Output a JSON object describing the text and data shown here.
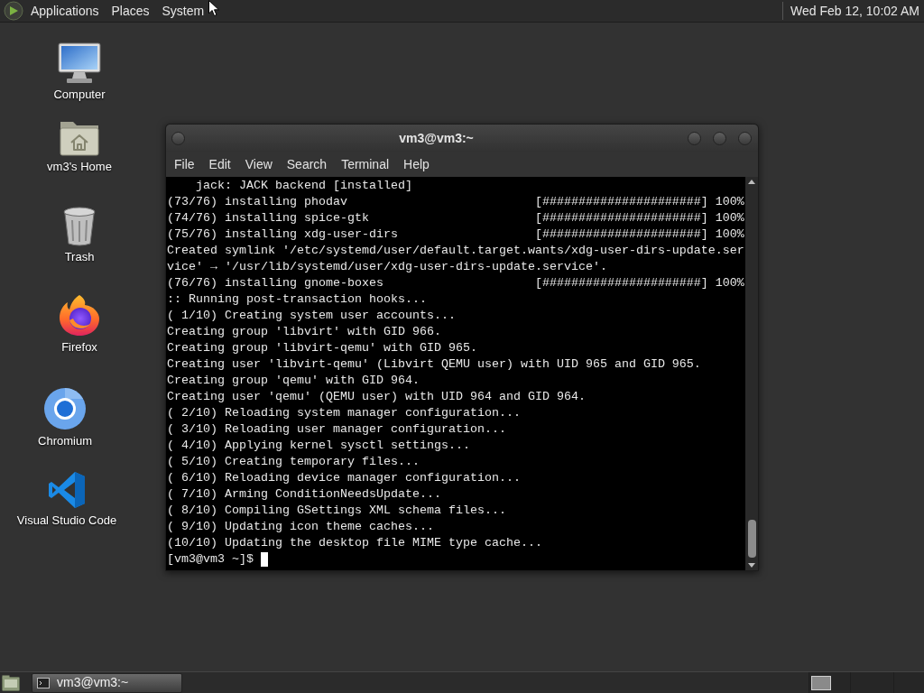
{
  "top_panel": {
    "menus": [
      "Applications",
      "Places",
      "System"
    ],
    "clock": "Wed Feb 12, 10:02 AM"
  },
  "desktop_icons": [
    {
      "label": "Computer",
      "kind": "computer"
    },
    {
      "label": "vm3's Home",
      "kind": "home"
    },
    {
      "label": "Trash",
      "kind": "trash"
    },
    {
      "label": "Firefox",
      "kind": "firefox"
    },
    {
      "label": "Chromium",
      "kind": "chromium"
    },
    {
      "label": "Visual Studio Code",
      "kind": "vscode"
    }
  ],
  "terminal_window": {
    "title": "vm3@vm3:~",
    "menu": [
      "File",
      "Edit",
      "View",
      "Search",
      "Terminal",
      "Help"
    ],
    "lines": [
      {
        "kind": "detail",
        "text": "jack: JACK backend [installed]"
      },
      {
        "kind": "progress",
        "text": "(73/76) installing phodav",
        "bar": "[######################] 100%"
      },
      {
        "kind": "progress",
        "text": "(74/76) installing spice-gtk",
        "bar": "[######################] 100%"
      },
      {
        "kind": "progress",
        "text": "(75/76) installing xdg-user-dirs",
        "bar": "[######################] 100%"
      },
      {
        "kind": "plain",
        "text": "Created symlink '/etc/systemd/user/default.target.wants/xdg-user-dirs-update.ser"
      },
      {
        "kind": "plain",
        "text": "vice' → '/usr/lib/systemd/user/xdg-user-dirs-update.service'."
      },
      {
        "kind": "progress",
        "text": "(76/76) installing gnome-boxes",
        "bar": "[######################] 100%"
      },
      {
        "kind": "plain",
        "text": ":: Running post-transaction hooks..."
      },
      {
        "kind": "plain",
        "text": "( 1/10) Creating system user accounts..."
      },
      {
        "kind": "plain",
        "text": "Creating group 'libvirt' with GID 966."
      },
      {
        "kind": "plain",
        "text": "Creating group 'libvirt-qemu' with GID 965."
      },
      {
        "kind": "plain",
        "text": "Creating user 'libvirt-qemu' (Libvirt QEMU user) with UID 965 and GID 965."
      },
      {
        "kind": "plain",
        "text": "Creating group 'qemu' with GID 964."
      },
      {
        "kind": "plain",
        "text": "Creating user 'qemu' (QEMU user) with UID 964 and GID 964."
      },
      {
        "kind": "plain",
        "text": "( 2/10) Reloading system manager configuration..."
      },
      {
        "kind": "plain",
        "text": "( 3/10) Reloading user manager configuration..."
      },
      {
        "kind": "plain",
        "text": "( 4/10) Applying kernel sysctl settings..."
      },
      {
        "kind": "plain",
        "text": "( 5/10) Creating temporary files..."
      },
      {
        "kind": "plain",
        "text": "( 6/10) Reloading device manager configuration..."
      },
      {
        "kind": "plain",
        "text": "( 7/10) Arming ConditionNeedsUpdate..."
      },
      {
        "kind": "plain",
        "text": "( 8/10) Compiling GSettings XML schema files..."
      },
      {
        "kind": "plain",
        "text": "( 9/10) Updating icon theme caches..."
      },
      {
        "kind": "plain",
        "text": "(10/10) Updating the desktop file MIME type cache..."
      }
    ],
    "prompt": "[vm3@vm3 ~]$"
  },
  "bottom_panel": {
    "tasks": [
      {
        "label": "vm3@vm3:~",
        "selected": true
      }
    ]
  }
}
